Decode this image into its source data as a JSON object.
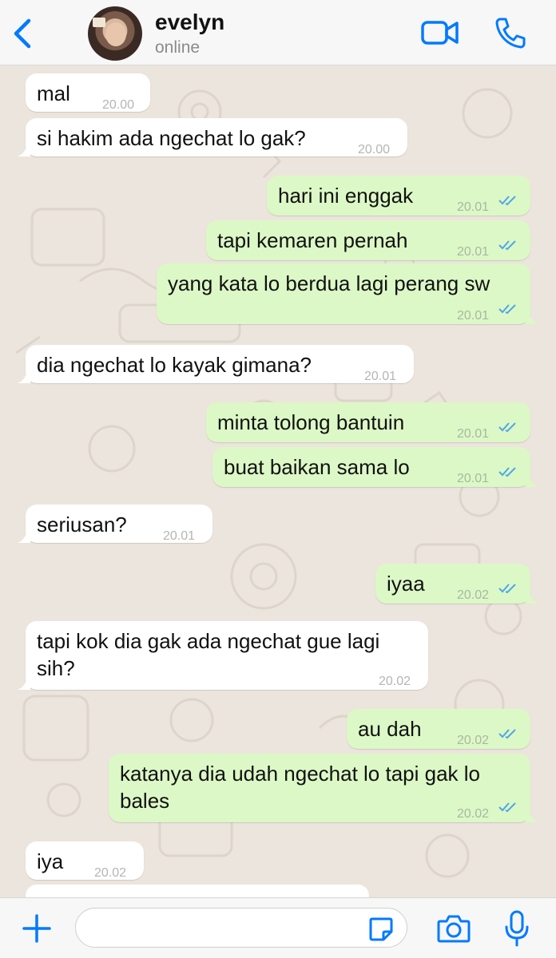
{
  "header": {
    "contact_name": "evelyn",
    "status": "online"
  },
  "messages": [
    {
      "side": "in",
      "text": "mal",
      "time": "20.00"
    },
    {
      "side": "in",
      "text": "si hakim ada ngechat lo gak?",
      "time": "20.00"
    },
    {
      "side": "out",
      "text": "hari ini enggak",
      "time": "20.01",
      "read": true
    },
    {
      "side": "out",
      "text": "tapi kemaren pernah",
      "time": "20.01",
      "read": true
    },
    {
      "side": "out",
      "text": "yang kata lo berdua lagi perang sw",
      "time": "20.01",
      "read": true
    },
    {
      "side": "in",
      "text": "dia ngechat lo kayak gimana?",
      "time": "20.01"
    },
    {
      "side": "out",
      "text": "minta tolong bantuin",
      "time": "20.01",
      "read": true
    },
    {
      "side": "out",
      "text": "buat baikan sama lo",
      "time": "20.01",
      "read": true
    },
    {
      "side": "in",
      "text": "seriusan?",
      "time": "20.01"
    },
    {
      "side": "out",
      "text": "iyaa",
      "time": "20.02",
      "read": true
    },
    {
      "side": "in",
      "text_line1": "tapi kok dia gak ada ngechat gue lagi",
      "text_line2": "sih?",
      "time": "20.02"
    },
    {
      "side": "out",
      "text": "au dah",
      "time": "20.02",
      "read": true
    },
    {
      "side": "out",
      "text_line1": "katanya dia udah ngechat lo tapi gak lo",
      "text_line2": "bales",
      "time": "20.02",
      "read": true
    },
    {
      "side": "in",
      "text": "iya",
      "time": "20.02"
    }
  ],
  "composer": {
    "placeholder": ""
  },
  "colors": {
    "accent": "#007aff",
    "incoming_bubble": "#ffffff",
    "outgoing_bubble": "#dcf8c6",
    "chat_background": "#ece5dd",
    "read_tick": "#4fa6e8"
  },
  "icons": [
    "back-chevron-icon",
    "video-call-icon",
    "phone-icon",
    "plus-icon",
    "sticker-icon",
    "camera-icon",
    "microphone-icon",
    "double-check-icon"
  ]
}
